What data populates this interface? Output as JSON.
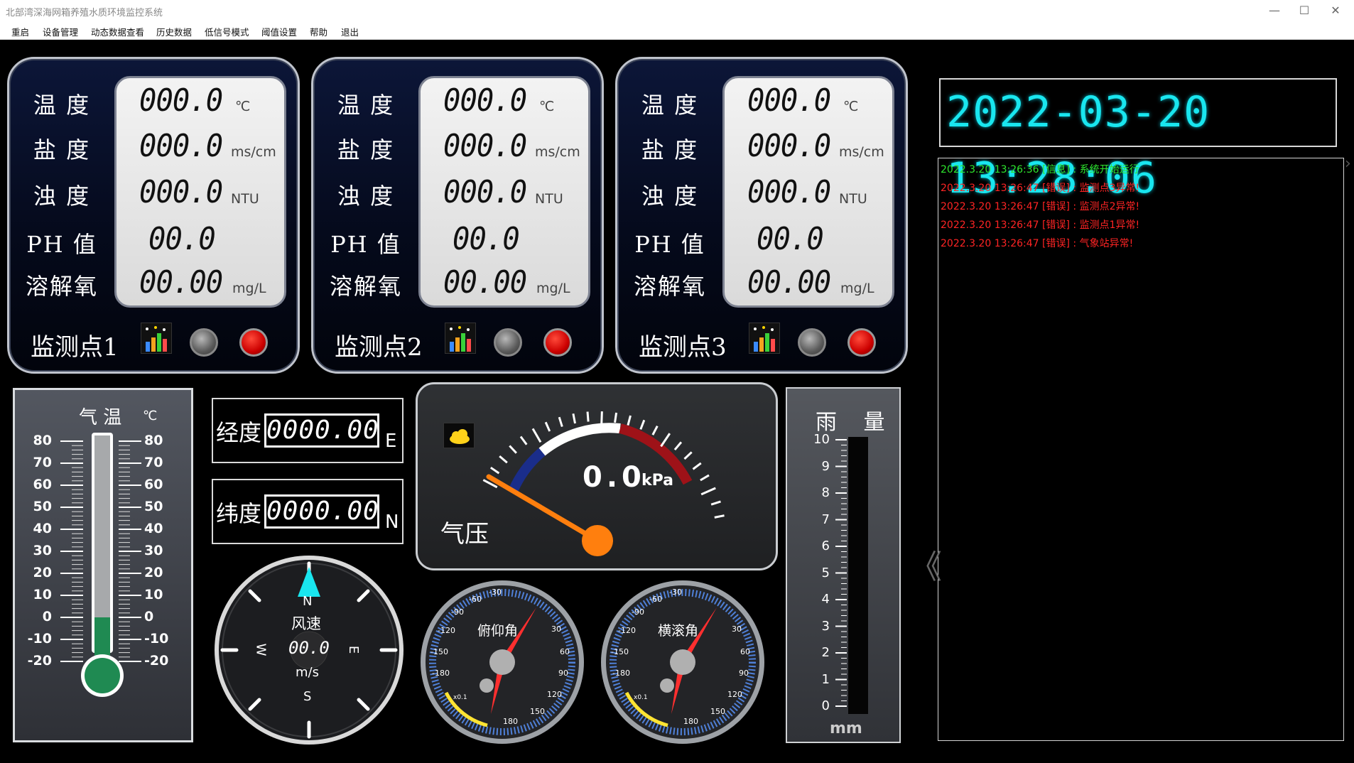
{
  "window": {
    "title": "北部湾深海网箱养殖水质环境监控系统",
    "controls": [
      "—",
      "☐",
      "✕"
    ]
  },
  "menu": [
    "重启",
    "设备管理",
    "动态数据查看",
    "历史数据",
    "低信号模式",
    "阈值设置",
    "帮助",
    "退出"
  ],
  "stations": [
    {
      "name": "监测点1",
      "labels": [
        "温 度",
        "盐 度",
        "浊 度",
        "PH 值",
        "溶解氧"
      ],
      "values": [
        "000.0",
        "000.0",
        "000.0",
        "00.0",
        "00.00"
      ],
      "units": [
        "℃",
        "ms/cm",
        "NTU",
        "",
        "mg/L"
      ]
    },
    {
      "name": "监测点2",
      "labels": [
        "温 度",
        "盐 度",
        "浊 度",
        "PH 值",
        "溶解氧"
      ],
      "values": [
        "000.0",
        "000.0",
        "000.0",
        "00.0",
        "00.00"
      ],
      "units": [
        "℃",
        "ms/cm",
        "NTU",
        "",
        "mg/L"
      ]
    },
    {
      "name": "监测点3",
      "labels": [
        "温 度",
        "盐 度",
        "浊 度",
        "PH 值",
        "溶解氧"
      ],
      "values": [
        "000.0",
        "000.0",
        "000.0",
        "00.0",
        "00.00"
      ],
      "units": [
        "℃",
        "ms/cm",
        "NTU",
        "",
        "mg/L"
      ]
    }
  ],
  "datetime": "2022-03-20 13:28:06",
  "log": [
    {
      "text": "2022.3.20 13:26:36  [信息] : 系统开始运行",
      "color": "#2ee62e"
    },
    {
      "text": "2022.3.20 13:26:47  [错误] : 监测点3异常!",
      "color": "#ff2424"
    },
    {
      "text": "2022.3.20 13:26:47  [错误] : 监测点2异常!",
      "color": "#ff2424"
    },
    {
      "text": "2022.3.20 13:26:47  [错误] : 监测点1异常!",
      "color": "#ff2424"
    },
    {
      "text": "2022.3.20 13:26:47  [错误] : 气象站异常!",
      "color": "#ff2424"
    }
  ],
  "air_temp": {
    "title": "气 温",
    "unit": "℃",
    "ticks": [
      "80",
      "70",
      "60",
      "50",
      "40",
      "30",
      "20",
      "10",
      "0",
      "-10",
      "-20"
    ],
    "value": 0
  },
  "longitude": {
    "label": "经度",
    "value": "0000.00",
    "dir": "E"
  },
  "latitude": {
    "label": "纬度",
    "value": "0000.00",
    "dir": "N"
  },
  "pressure": {
    "label": "气压",
    "value": "0.0",
    "unit": "kPa"
  },
  "wind": {
    "n": "N",
    "s": "S",
    "e": "E",
    "w": "W",
    "label": "风速",
    "value": "00.0",
    "unit": "m/s"
  },
  "pitch": {
    "label": "俯仰角",
    "ticks": [
      "-30",
      "-60",
      "-90",
      "-120",
      "-150",
      "-180",
      "30",
      "60",
      "90",
      "120",
      "150",
      "180"
    ],
    "mult": "x0.1"
  },
  "roll": {
    "label": "横滚角",
    "ticks": [
      "-30",
      "-60",
      "-90",
      "-120",
      "-150",
      "-180",
      "30",
      "60",
      "90",
      "120",
      "150",
      "180"
    ],
    "mult": "x0.1"
  },
  "rain": {
    "title": "雨 量",
    "unit": "mm",
    "ticks": [
      "10",
      "9",
      "8",
      "7",
      "6",
      "5",
      "4",
      "3",
      "2",
      "1",
      "0"
    ],
    "value": 0
  },
  "colors": {
    "lcd_text": "#111111",
    "clock": "#19e6ef",
    "ok": "#2ee62e",
    "error": "#ff2424",
    "thermo_fill": "#1f8a52",
    "pointer": "#ff7f0e"
  }
}
